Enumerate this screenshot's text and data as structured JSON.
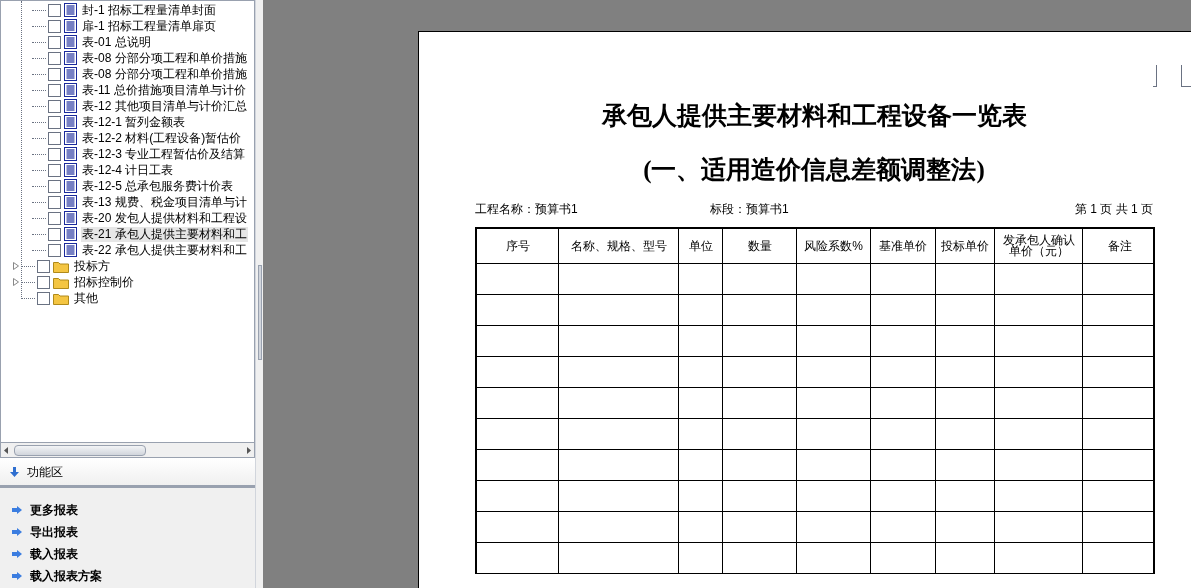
{
  "tree": {
    "items": [
      {
        "kind": "report",
        "label": "封-1 招标工程量清单封面",
        "checked": false,
        "selected": false
      },
      {
        "kind": "report",
        "label": "扉-1 招标工程量清单扉页",
        "checked": false,
        "selected": false
      },
      {
        "kind": "report",
        "label": "表-01 总说明",
        "checked": false,
        "selected": false
      },
      {
        "kind": "report",
        "label": "表-08 分部分项工程和单价措施",
        "checked": false,
        "selected": false
      },
      {
        "kind": "report",
        "label": "表-08 分部分项工程和单价措施",
        "checked": false,
        "selected": false
      },
      {
        "kind": "report",
        "label": "表-11 总价措施项目清单与计价",
        "checked": false,
        "selected": false
      },
      {
        "kind": "report",
        "label": "表-12 其他项目清单与计价汇总",
        "checked": false,
        "selected": false
      },
      {
        "kind": "report",
        "label": "表-12-1 暂列金额表",
        "checked": false,
        "selected": false
      },
      {
        "kind": "report",
        "label": "表-12-2 材料(工程设备)暂估价",
        "checked": false,
        "selected": false
      },
      {
        "kind": "report",
        "label": "表-12-3 专业工程暂估价及结算",
        "checked": false,
        "selected": false
      },
      {
        "kind": "report",
        "label": "表-12-4 计日工表",
        "checked": false,
        "selected": false
      },
      {
        "kind": "report",
        "label": "表-12-5 总承包服务费计价表",
        "checked": false,
        "selected": false
      },
      {
        "kind": "report",
        "label": "表-13 规费、税金项目清单与计",
        "checked": false,
        "selected": false
      },
      {
        "kind": "report",
        "label": "表-20 发包人提供材料和工程设",
        "checked": false,
        "selected": false
      },
      {
        "kind": "report",
        "label": "表-21 承包人提供主要材料和工",
        "checked": false,
        "selected": true
      },
      {
        "kind": "report",
        "label": "表-22 承包人提供主要材料和工",
        "checked": false,
        "selected": false
      },
      {
        "kind": "folder",
        "label": "投标方",
        "checked": false,
        "selected": false,
        "expandable": true
      },
      {
        "kind": "folder",
        "label": "招标控制价",
        "checked": false,
        "selected": false,
        "expandable": true
      },
      {
        "kind": "folder",
        "label": "其他",
        "checked": false,
        "selected": false,
        "expandable": false
      }
    ]
  },
  "function_panel": {
    "title": "功能区",
    "links": [
      "更多报表",
      "导出报表",
      "载入报表",
      "载入报表方案"
    ]
  },
  "document": {
    "title": "承包人提供主要材料和工程设备一览表",
    "subtitle": "(一、适用造价信息差额调整法)",
    "project": "工程名称：预算书1",
    "section": "标段：预算书1",
    "page_info": "第 1 页  共 1 页",
    "columns": [
      "序号",
      "名称、规格、型号",
      "单位",
      "数量",
      "风险系数%",
      "基准单价",
      "投标单价",
      "发承包人确认单价（元）",
      "备注"
    ]
  }
}
